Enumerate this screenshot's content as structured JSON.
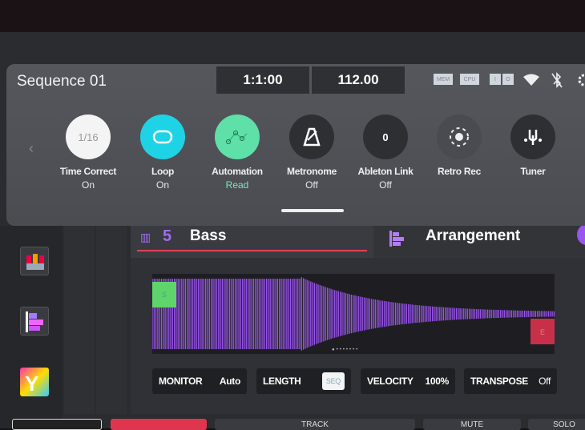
{
  "header": {
    "sequence_title": "Sequence 01",
    "position": "1:1:00",
    "tempo": "112.00",
    "status": [
      "MEM",
      "CPU",
      "I",
      "O"
    ]
  },
  "quick_buttons": [
    {
      "label": "Time Correct",
      "value": "On",
      "icon_text": "1/16",
      "color": "#f4f4f4"
    },
    {
      "label": "Loop",
      "value": "On",
      "icon": "loop-icon",
      "color": "#1fd3e6"
    },
    {
      "label": "Automation",
      "value": "Read",
      "icon": "automation-icon",
      "color": "#5ee0a8",
      "value_color": "#7de8b8"
    },
    {
      "label": "Metronome",
      "value": "Off",
      "icon": "metronome-icon",
      "color": "#2e2f33"
    },
    {
      "label": "Ableton Link",
      "value": "Off",
      "icon_text": "0",
      "color": "#2e2f33"
    },
    {
      "label": "Retro Rec",
      "value": "",
      "icon": "retro-rec-icon",
      "color": "#4a4b50"
    },
    {
      "label": "Tuner",
      "value": "",
      "icon": "tuner-icon",
      "color": "#2e2f33"
    }
  ],
  "track": {
    "number": "5",
    "name": "Bass",
    "arrangement_label": "Arrangement"
  },
  "waveform": {
    "start_marker": "S",
    "end_marker": "E",
    "accent": "#9b55f0"
  },
  "controls": [
    {
      "label": "MONITOR",
      "value": "Auto"
    },
    {
      "label": "LENGTH",
      "value": "SEQ"
    },
    {
      "label": "VELOCITY",
      "value": "100%"
    },
    {
      "label": "TRANSPOSE",
      "value": "Off"
    }
  ],
  "bottom_bar": [
    "TRACK",
    "MUTE",
    "SOLO"
  ]
}
